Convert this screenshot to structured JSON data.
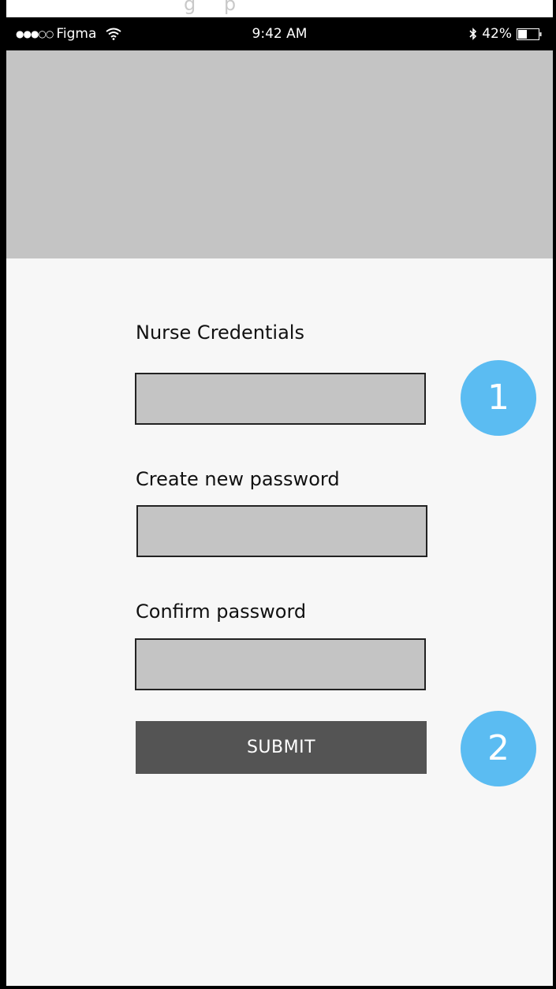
{
  "ghost_text": "g p",
  "status_bar": {
    "carrier": "Figma",
    "signal": "●●●○○",
    "time": "9:42 AM",
    "battery_percent": "42%",
    "icons": [
      "wifi-icon",
      "bluetooth-icon",
      "battery-icon"
    ]
  },
  "form": {
    "fields": [
      {
        "label": "Nurse Credentials",
        "value": ""
      },
      {
        "label": "Create new password",
        "value": ""
      },
      {
        "label": "Confirm password",
        "value": ""
      }
    ],
    "submit_label": "SUBMIT"
  },
  "annotations": {
    "badge_1": "1",
    "badge_2": "2"
  },
  "colors": {
    "badge": "#5bbcf2",
    "field_fill": "#c4c4c4",
    "hero": "#c4c4c4",
    "submit": "#545454",
    "status_bar": "#000000"
  }
}
